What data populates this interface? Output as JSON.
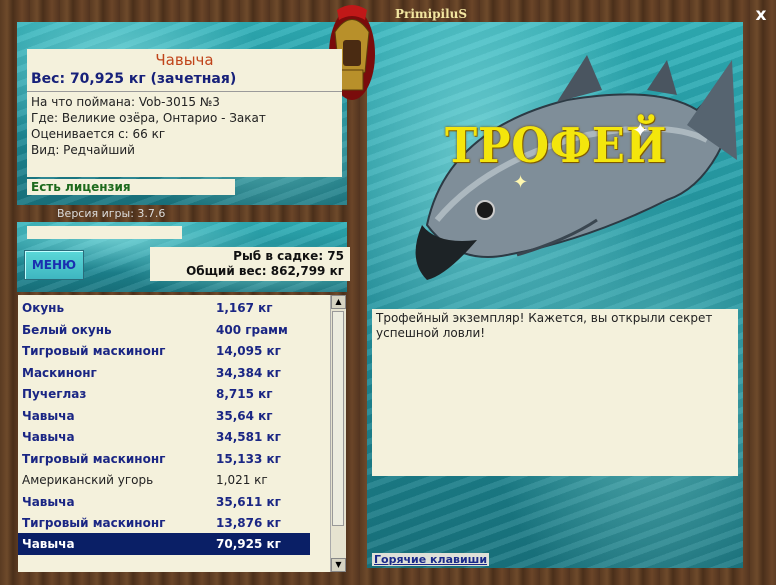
{
  "window": {
    "title": "PrimipiluS",
    "close_symbol": "x"
  },
  "catch": {
    "name": "Чавыча",
    "weight_line": "Вес: 70,925 кг (зачетная)",
    "lure_line": "На что поймана: Vob-3015 №3",
    "place_line": "Где: Великие озёра, Онтарио - Закат",
    "eval_line": "Оценивается с: 66 кг",
    "kind_line": "Вид: Редчайший"
  },
  "license": "Есть лицензия",
  "version": "Версия игры: 3.7.6",
  "menu_button": "МЕНЮ",
  "stats": {
    "fish_count": "Рыб в садке: 75",
    "total_weight": "Общий вес: 862,799 кг"
  },
  "fish_list": [
    {
      "name": "Окунь",
      "weight": "1,167 кг",
      "style": "bold"
    },
    {
      "name": "Белый окунь",
      "weight": "400 грамм",
      "style": "bold"
    },
    {
      "name": "Тигровый маскинонг",
      "weight": "14,095 кг",
      "style": "bold"
    },
    {
      "name": "Маскинонг",
      "weight": "34,384 кг",
      "style": "bold"
    },
    {
      "name": "Пучеглаз",
      "weight": "8,715 кг",
      "style": "bold"
    },
    {
      "name": "Чавыча",
      "weight": "35,64 кг",
      "style": "bold"
    },
    {
      "name": "Чавыча",
      "weight": "34,581 кг",
      "style": "bold"
    },
    {
      "name": "Тигровый маскинонг",
      "weight": "15,133 кг",
      "style": "bold"
    },
    {
      "name": "Американский угорь",
      "weight": "1,021 кг",
      "style": "plain"
    },
    {
      "name": "Чавыча",
      "weight": "35,611 кг",
      "style": "bold"
    },
    {
      "name": "Тигровый маскинонг",
      "weight": "13,876 кг",
      "style": "bold"
    },
    {
      "name": "Чавыча",
      "weight": "70,925 кг",
      "style": "selected"
    }
  ],
  "trophy": {
    "label": "ТРОФЕЙ"
  },
  "message": "Трофейный экземпляр! Кажется, вы открыли секрет успешной ловли!",
  "hotkeys_link": "Горячие клавиши",
  "colors": {
    "title_text": "#f2e6a0",
    "fish_name": "#c0441a",
    "weight_text": "#17217a",
    "license_text": "#1d6a1d",
    "list_text": "#1a2684",
    "selected_bg": "#0a1f66",
    "trophy_text": "#f4e60c"
  }
}
